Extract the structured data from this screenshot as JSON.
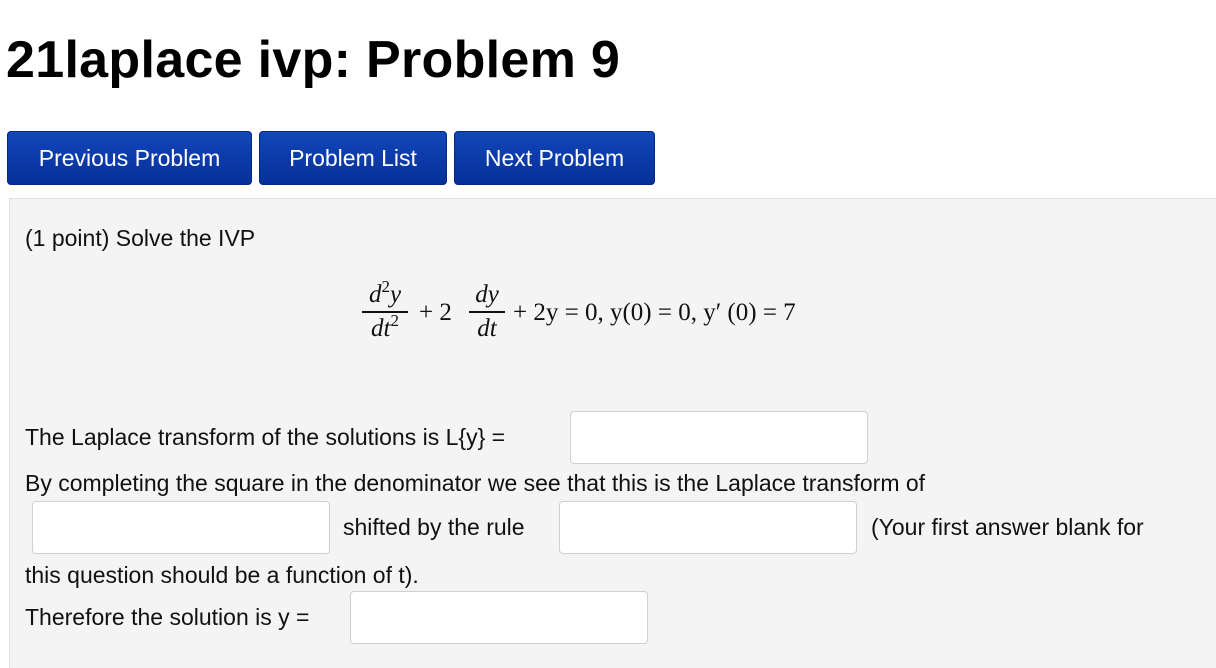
{
  "title": "21laplace ivp: Problem 9",
  "nav": {
    "previous": "Previous Problem",
    "list": "Problem List",
    "next": "Next Problem"
  },
  "problem": {
    "intro": "(1 point) Solve the IVP",
    "equation": {
      "d2y": "d",
      "d2y_exp": "2",
      "d2y_var": "y",
      "dt2": "dt",
      "dt2_exp": "2",
      "plus2": "+ 2",
      "dy": "dy",
      "dt": "dt",
      "rest": "+ 2y = 0, y(0) = 0, y′ (0) = 7"
    },
    "line1": "The Laplace transform of the solutions is L{y} =",
    "line2": "By completing the square in the denominator we see that this is the Laplace transform of",
    "line3_mid": "shifted by the rule",
    "line3_end": "(Your first answer blank for",
    "line4": "this question should be a function of t).",
    "line5": "Therefore the solution is y =",
    "answers": {
      "laplace": "",
      "function_of_t": "",
      "rule": "",
      "solution": ""
    }
  },
  "colors": {
    "button_bg": "#0a3aa6",
    "panel_bg": "#f4f4f4"
  }
}
